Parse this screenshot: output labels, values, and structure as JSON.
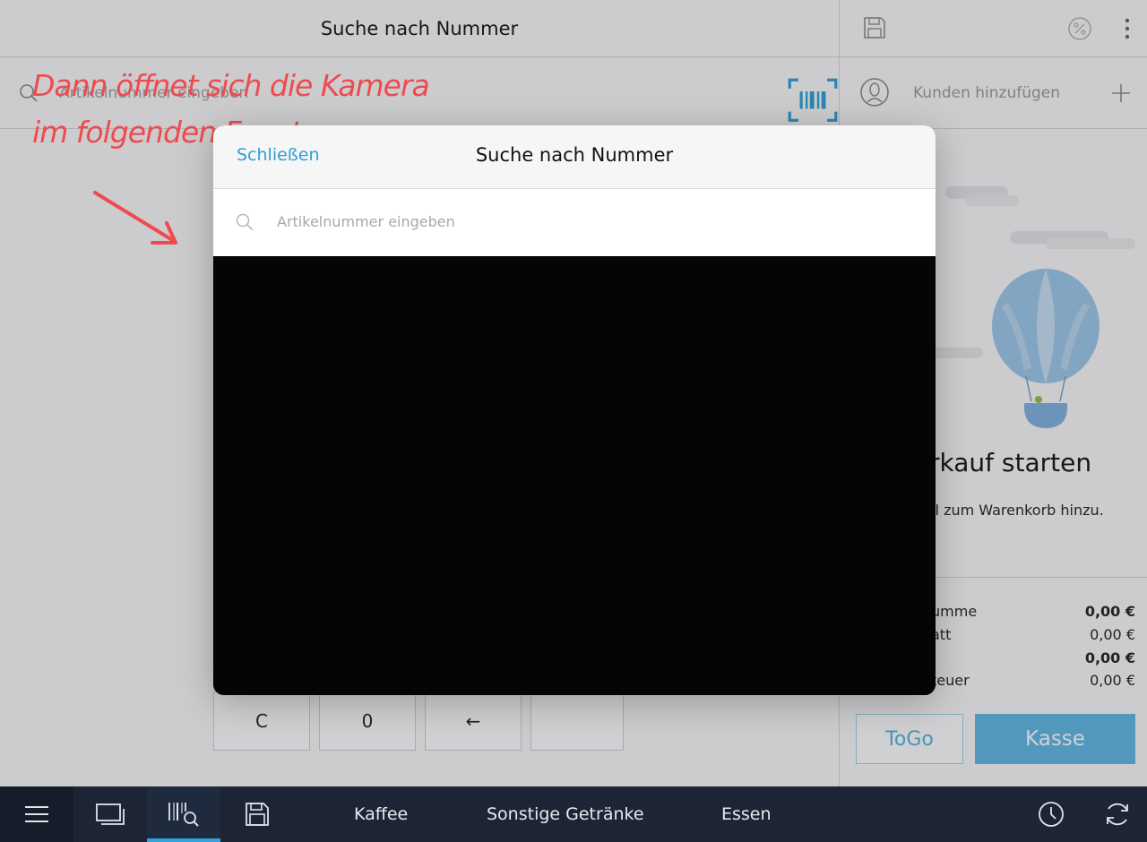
{
  "left": {
    "header_title": "Suche nach Nummer",
    "search_placeholder": "Artikelnummer eingeben",
    "keypad": [
      "C",
      "0",
      "←",
      ""
    ]
  },
  "right": {
    "customer_label": "Kunden hinzufügen",
    "empty_title": "rkauf starten",
    "empty_subtitle": "kel zum Warenkorb hinzu.",
    "totals": [
      {
        "label": "umme",
        "value": "0,00 €",
        "bold": true
      },
      {
        "label": "att",
        "value": "0,00 €",
        "bold": false
      },
      {
        "label": "",
        "value": "0,00 €",
        "bold": true
      },
      {
        "label": "teuer",
        "value": "0,00 €",
        "bold": false
      }
    ],
    "togo_label": "ToGo",
    "kasse_label": "Kasse"
  },
  "annotation": {
    "line1": "Dann öffnet sich die Kamera",
    "line2": "im folgenden Fenster"
  },
  "modal": {
    "close_label": "Schließen",
    "title": "Suche nach Nummer",
    "search_placeholder": "Artikelnummer eingeben"
  },
  "bottom_bar": {
    "categories": [
      "Kaffee",
      "Sonstige Getränke",
      "Essen"
    ]
  },
  "colors": {
    "accent": "#2fa4df",
    "annotation": "#ef4b4f",
    "bottom_bar": "#1d2535",
    "camera": "#050505"
  },
  "icons": [
    "menu-icon",
    "screens-icon",
    "barcode-search-icon",
    "save-icon",
    "clock-icon",
    "sync-icon",
    "more-icon",
    "discount-icon",
    "user-icon",
    "plus-icon",
    "barcode-scan-icon",
    "search-icon",
    "balloon-illustration"
  ]
}
